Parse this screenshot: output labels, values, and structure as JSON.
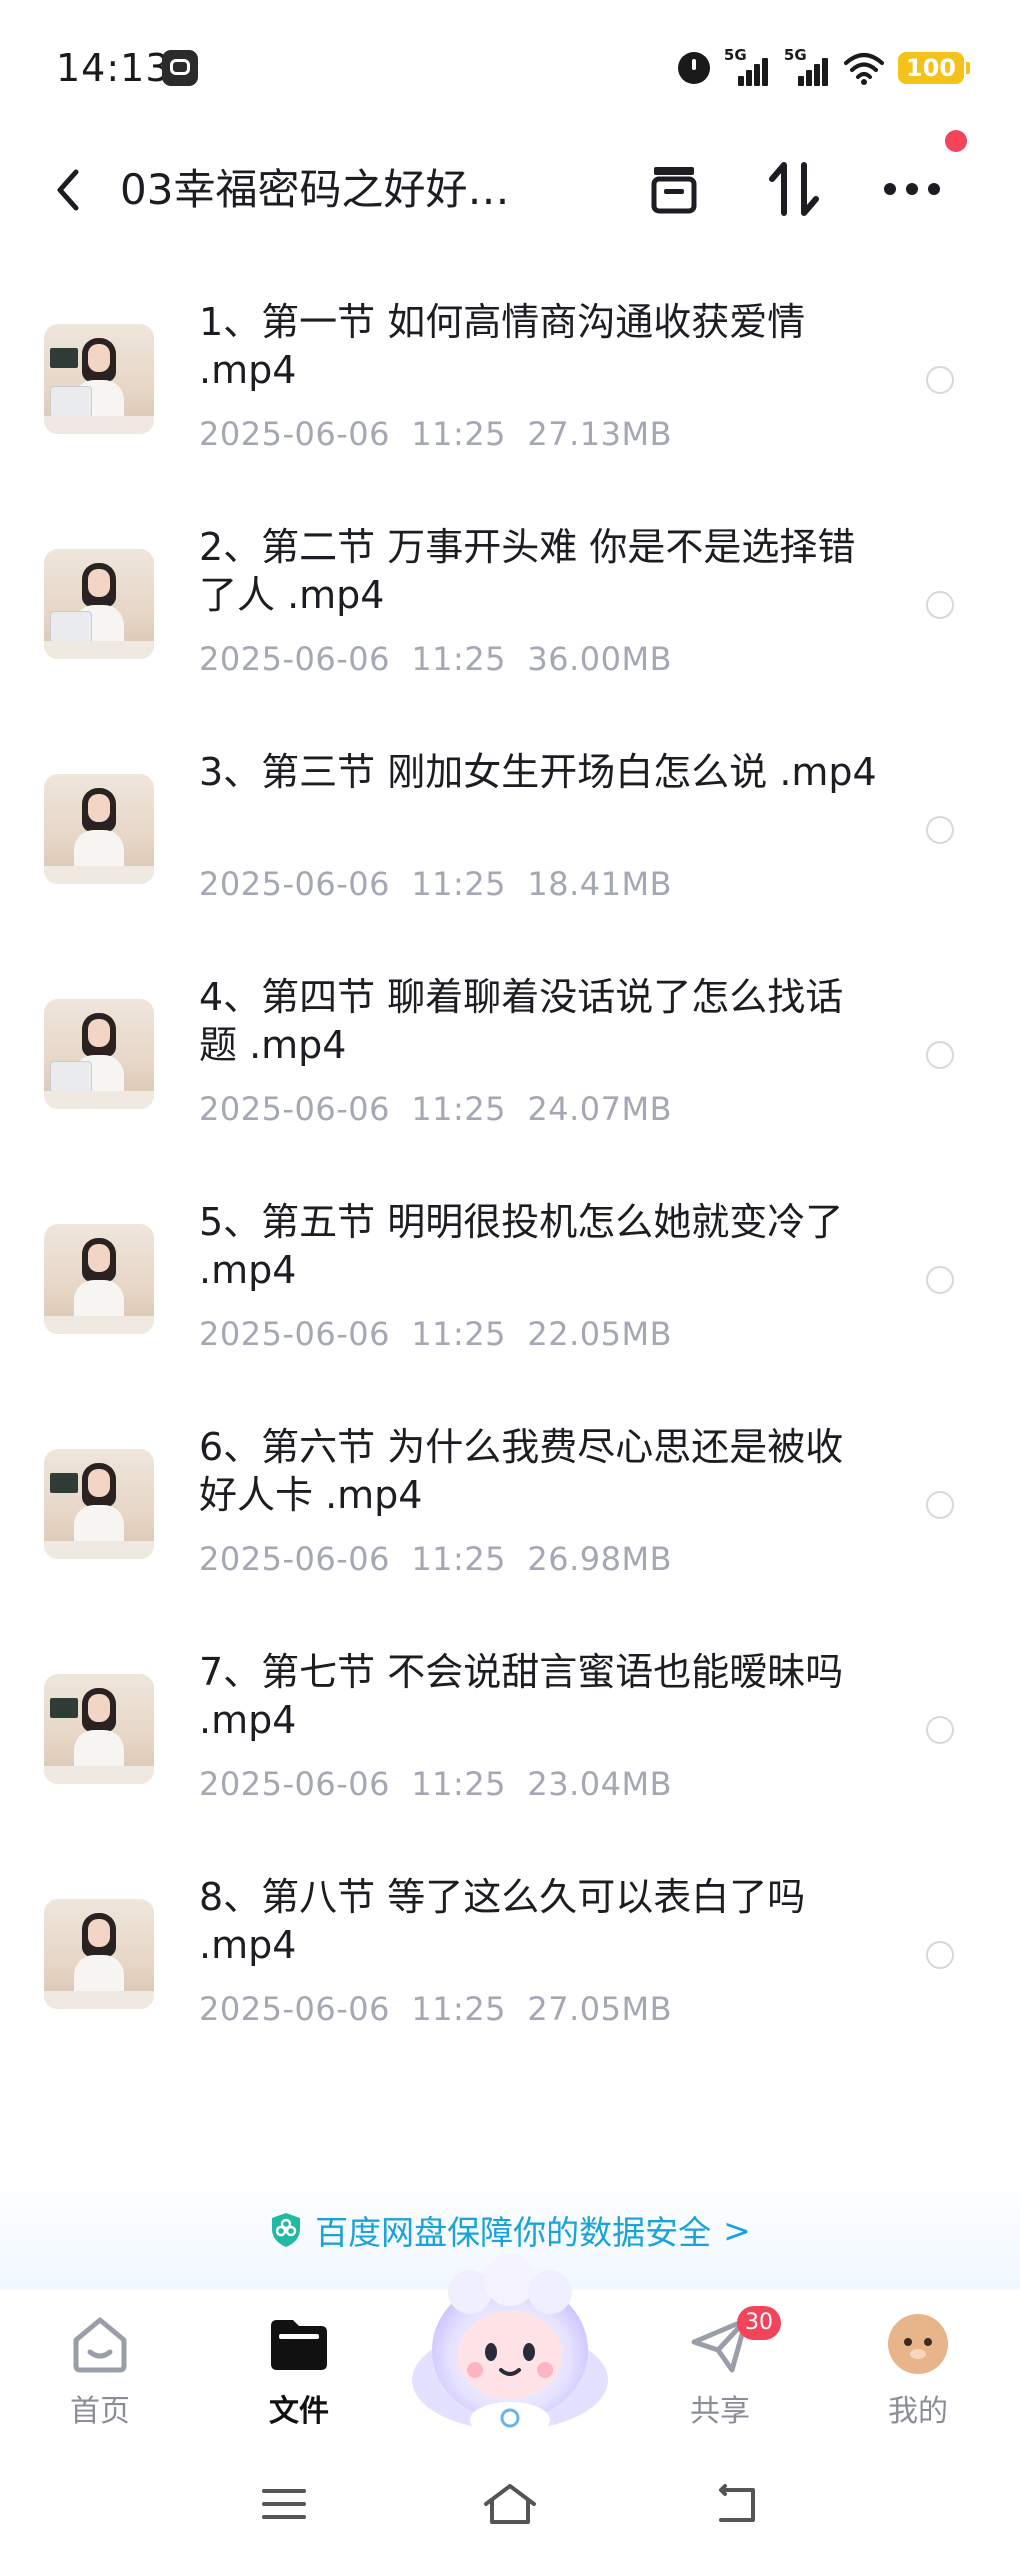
{
  "status_bar": {
    "time": "14:13",
    "network_1": "5G",
    "network_2": "5G",
    "battery": "100"
  },
  "header": {
    "title": "03幸福密码之好好…",
    "back_icon": "chevron-left-icon",
    "actions": [
      "archive-icon",
      "sort-icon",
      "more-icon"
    ]
  },
  "files": [
    {
      "name": "1、第一节  如何高情商沟通收获爱情 .mp4",
      "meta": "2025-06-06  11:25  27.13MB"
    },
    {
      "name": "2、第二节  万事开头难  你是不是选择错了人 .mp4",
      "meta": "2025-06-06  11:25  36.00MB"
    },
    {
      "name": "3、第三节  刚加女生开场白怎么说 .mp4",
      "meta": "2025-06-06  11:25  18.41MB"
    },
    {
      "name": "4、第四节   聊着聊着没话说了怎么找话题 .mp4",
      "meta": "2025-06-06  11:25  24.07MB"
    },
    {
      "name": "5、第五节  明明很投机怎么她就变冷了 .mp4",
      "meta": "2025-06-06  11:25  22.05MB"
    },
    {
      "name": "6、第六节  为什么我费尽心思还是被收好人卡 .mp4",
      "meta": "2025-06-06  11:25  26.98MB"
    },
    {
      "name": "7、第七节   不会说甜言蜜语也能暧昧吗 .mp4",
      "meta": "2025-06-06  11:25  23.04MB"
    },
    {
      "name": "8、第八节  等了这么久可以表白了吗 .mp4",
      "meta": "2025-06-06  11:25  27.05MB"
    }
  ],
  "security_banner": {
    "text": "百度网盘保障你的数据安全",
    "chevron": ">"
  },
  "bottom_nav": {
    "items": [
      {
        "label": "首页",
        "icon": "home-icon"
      },
      {
        "label": "文件",
        "icon": "folder-icon",
        "active": true
      },
      {
        "label": "共享",
        "icon": "send-icon",
        "badge": "30"
      },
      {
        "label": "我的",
        "icon": "avatar-icon"
      }
    ]
  },
  "colors": {
    "accent": "#1aa3d8",
    "badge": "#f2455c",
    "battery": "#f4c21b",
    "meta_text": "#a4a8b4"
  }
}
